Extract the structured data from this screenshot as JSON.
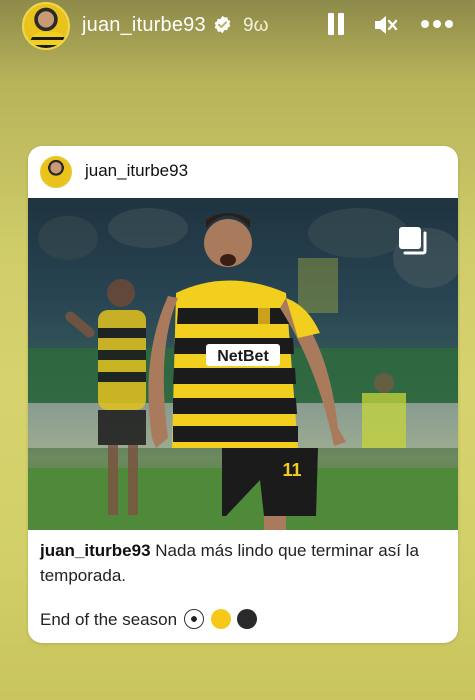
{
  "story": {
    "username": "juan_iturbe93",
    "time_ago": "9ω"
  },
  "post": {
    "username": "juan_iturbe93",
    "caption_user": "juan_iturbe93",
    "caption_text": "Nada más lindo que terminar así la temporada.",
    "caption_line2": "End of the season",
    "photo_shirt_sponsor": "NetBet",
    "photo_shirt_number": "11"
  },
  "icons": {
    "verified": "verified-badge-icon",
    "pause": "pause-icon",
    "mute": "speaker-muted-icon",
    "more": "more-options-icon",
    "multi": "multi-photo-icon",
    "emoji": [
      "soccer-ball-icon",
      "yellow-circle-icon",
      "black-circle-icon"
    ]
  },
  "colors": {
    "background": "#d6d36e",
    "card": "#ffffff",
    "jersey_yellow": "#f2cf1e",
    "jersey_black": "#1b1b1b"
  }
}
